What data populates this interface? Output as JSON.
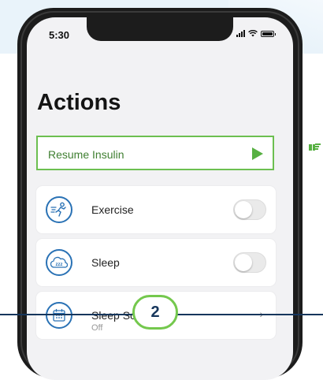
{
  "status_bar": {
    "time": "5:30"
  },
  "screen": {
    "title": "Actions",
    "resume_action": {
      "label": "Resume Insulin"
    },
    "items": [
      {
        "label": "Exercise",
        "icon": "exercise-icon",
        "control": "toggle",
        "on": false
      },
      {
        "label": "Sleep",
        "icon": "sleep-icon",
        "control": "toggle",
        "on": false
      },
      {
        "label": "Sleep Schedules",
        "sublabel": "Off",
        "icon": "calendar-icon",
        "control": "chevron"
      }
    ]
  },
  "step": {
    "number": "2"
  },
  "colors": {
    "accent_green": "#6cbf50",
    "icon_blue": "#2a72b5",
    "navy": "#16365c",
    "background_band": "#e9f3fa"
  }
}
